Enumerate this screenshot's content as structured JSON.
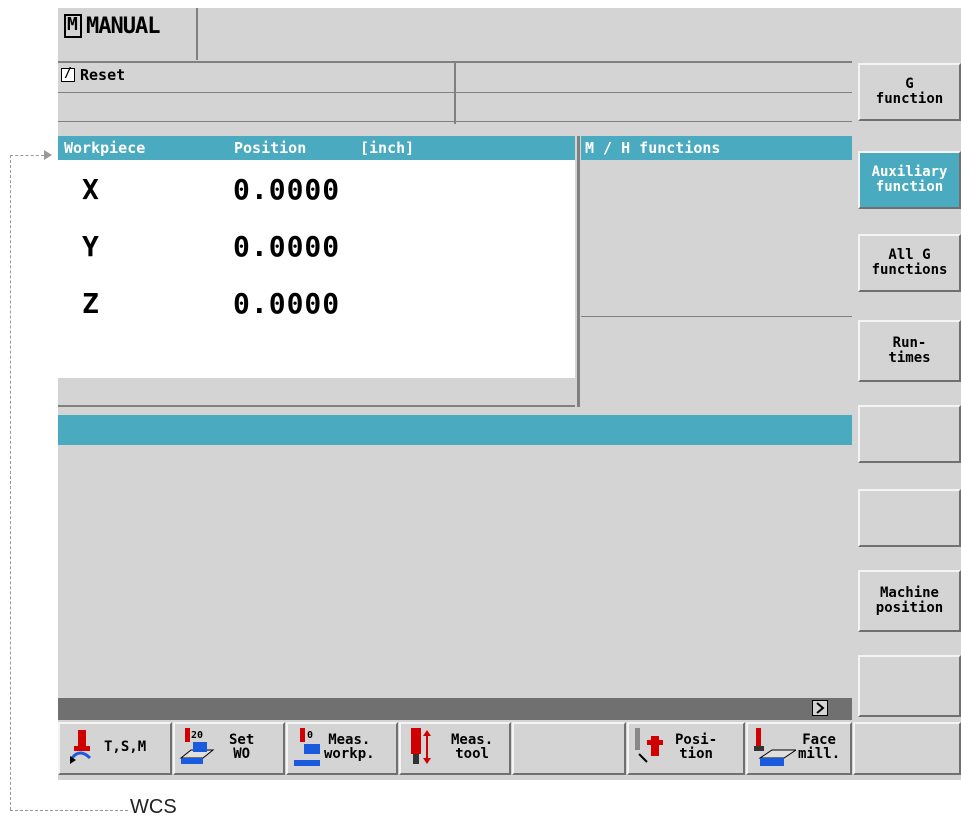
{
  "mode": {
    "icon": "M",
    "title": "MANUAL"
  },
  "status": {
    "reset_label": "Reset"
  },
  "position_panel": {
    "header_workpiece": "Workpiece",
    "header_position": "Position",
    "header_unit": "[inch]",
    "rows": [
      {
        "axis": "X",
        "value": "0.0000"
      },
      {
        "axis": "Y",
        "value": "0.0000"
      },
      {
        "axis": "Z",
        "value": "0.0000"
      }
    ]
  },
  "mh_panel": {
    "header": "M / H functions"
  },
  "right_softkeys": [
    {
      "label": "G\nfunction",
      "active": false
    },
    {
      "label": "Auxiliary\nfunction",
      "active": true
    },
    {
      "label": "All G\nfunctions",
      "active": false
    },
    {
      "label": "Run-\ntimes",
      "active": false
    },
    {
      "label": "",
      "active": false
    },
    {
      "label": "",
      "active": false
    },
    {
      "label": "Machine\nposition",
      "active": false
    },
    {
      "label": "",
      "active": false
    }
  ],
  "bottom_softkeys": [
    {
      "label": "T,S,M",
      "icon": "tool-spindle-icon"
    },
    {
      "label": "Set\nWO",
      "icon": "set-zero-offset-icon",
      "icon_text": "20"
    },
    {
      "label": "Meas.\nworkp.",
      "icon": "measure-workpiece-icon",
      "icon_text": "0"
    },
    {
      "label": "Meas.\ntool",
      "icon": "measure-tool-icon"
    },
    {
      "label": "",
      "icon": ""
    },
    {
      "label": "Posi-\ntion",
      "icon": "position-icon"
    },
    {
      "label": "Face\nmill.",
      "icon": "face-mill-icon"
    },
    {
      "label": "",
      "icon": ""
    }
  ],
  "annotation": {
    "label": "WCS"
  },
  "colors": {
    "accent": "#4aaabf",
    "background": "#d4d4d4",
    "arrow_red": "#d00000",
    "tool_blue": "#1a5adc"
  }
}
